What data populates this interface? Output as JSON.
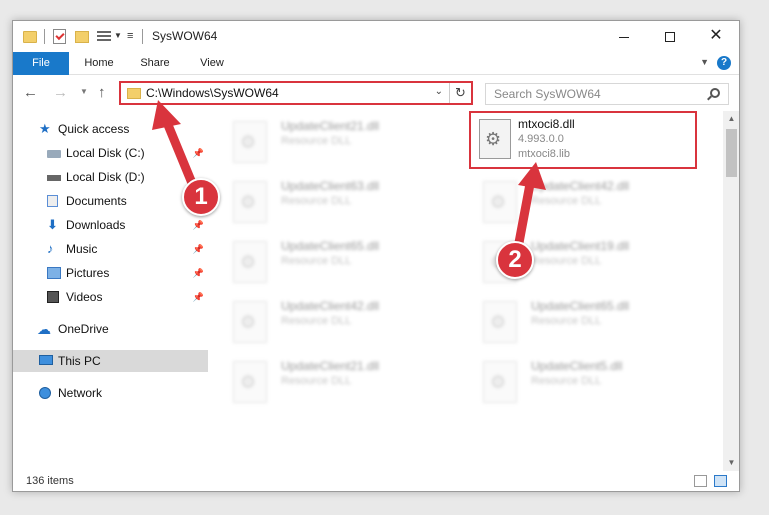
{
  "window": {
    "title": "SysWOW64",
    "controls": {
      "minimize": "minimize",
      "maximize": "maximize",
      "close": "✕"
    }
  },
  "ribbon": {
    "tabs": [
      "File",
      "Home",
      "Share",
      "View"
    ],
    "help": "?"
  },
  "address": {
    "path": "C:\\Windows\\SysWOW64",
    "refresh": "↻"
  },
  "search": {
    "placeholder": "Search SysWOW64"
  },
  "nav": {
    "items": [
      {
        "label": "Quick access",
        "icon": "star-icon",
        "pinned": false
      },
      {
        "label": "Local Disk (C:)",
        "icon": "drive-icon",
        "pinned": true
      },
      {
        "label": "Local Disk (D:)",
        "icon": "drive-icon",
        "pinned": false
      },
      {
        "label": "Documents",
        "icon": "documents-icon",
        "pinned": true
      },
      {
        "label": "Downloads",
        "icon": "downloads-icon",
        "pinned": true
      },
      {
        "label": "Music",
        "icon": "music-icon",
        "pinned": true
      },
      {
        "label": "Pictures",
        "icon": "pictures-icon",
        "pinned": true
      },
      {
        "label": "Videos",
        "icon": "videos-icon",
        "pinned": true
      },
      {
        "label": "OneDrive",
        "icon": "cloud-icon",
        "pinned": false
      },
      {
        "label": "This PC",
        "icon": "pc-icon",
        "pinned": false,
        "selected": true
      },
      {
        "label": "Network",
        "icon": "network-icon",
        "pinned": false
      }
    ]
  },
  "files": {
    "highlighted": {
      "name": "mtxoci8.dll",
      "version": "4.993.0.0",
      "sub": "mtxoci8.lib"
    },
    "left_column": [
      {
        "name": "UpdateClient21.dll",
        "sub": "Resource DLL"
      },
      {
        "name": "UpdateClient63.dll",
        "sub": "Resource DLL"
      },
      {
        "name": "UpdateClient65.dll",
        "sub": "Resource DLL"
      },
      {
        "name": "UpdateClient42.dll",
        "sub": "Resource DLL"
      },
      {
        "name": "UpdateClient21.dll",
        "sub": "Resource DLL"
      }
    ],
    "right_column": [
      {
        "name": "UpdateClient42.dll",
        "sub": "Resource DLL"
      },
      {
        "name": "UpdateClient19.dll",
        "sub": "Resource DLL"
      },
      {
        "name": "UpdateClient65.dll",
        "sub": "Resource DLL"
      },
      {
        "name": "UpdateClient5.dll",
        "sub": "Resource DLL"
      }
    ]
  },
  "status": {
    "count": "136 items"
  },
  "annotations": {
    "step1": "1",
    "step2": "2",
    "color": "#d9343d"
  }
}
